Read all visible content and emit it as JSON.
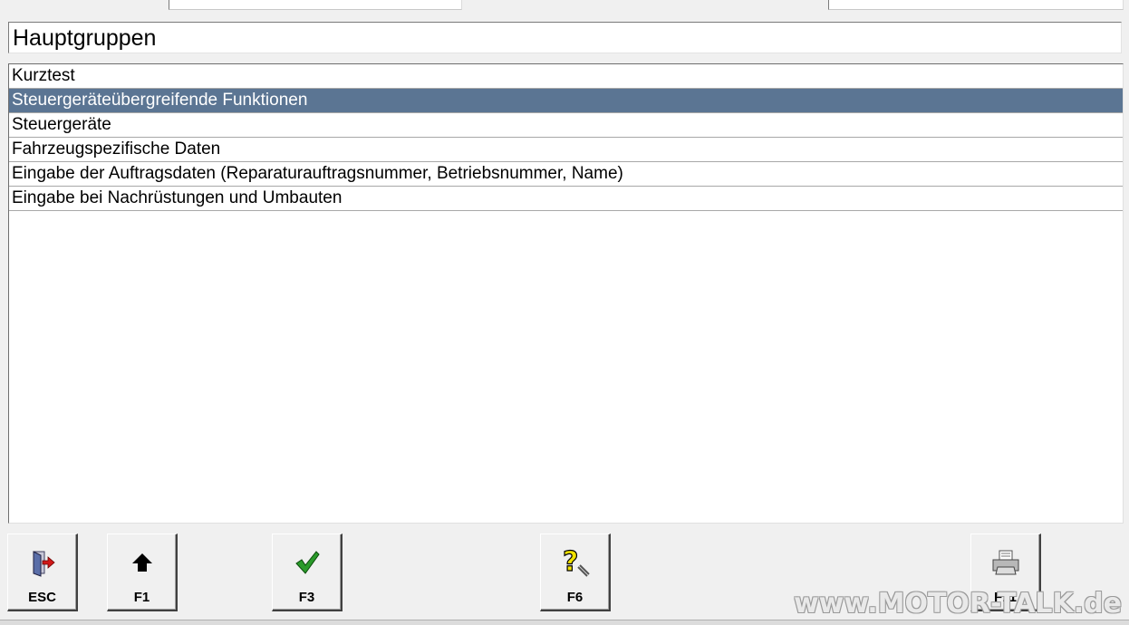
{
  "window": {
    "title": "Hauptgruppen"
  },
  "main_list": {
    "items": [
      {
        "label": "Kurztest",
        "selected": false
      },
      {
        "label": "Steuergeräteübergreifende Funktionen",
        "selected": true
      },
      {
        "label": "Steuergeräte",
        "selected": false
      },
      {
        "label": "Fahrzeugspezifische Daten",
        "selected": false
      },
      {
        "label": "Eingabe der Auftragsdaten (Reparaturauftragsnummer, Betriebsnummer, Name)",
        "selected": false
      },
      {
        "label": "Eingabe bei Nachrüstungen und Umbauten",
        "selected": false
      }
    ],
    "selected_color": "#5b7593"
  },
  "toolbar": {
    "esc": {
      "label": "ESC",
      "icon": "exit-door-icon"
    },
    "f1": {
      "label": "F1",
      "icon": "arrow-up-icon"
    },
    "f3": {
      "label": "F3",
      "icon": "checkmark-icon"
    },
    "f6": {
      "label": "F6",
      "icon": "help-question-icon"
    },
    "f11": {
      "label": "F11",
      "icon": "printer-icon"
    }
  },
  "watermark": "www.MOTOR-TALK.de"
}
